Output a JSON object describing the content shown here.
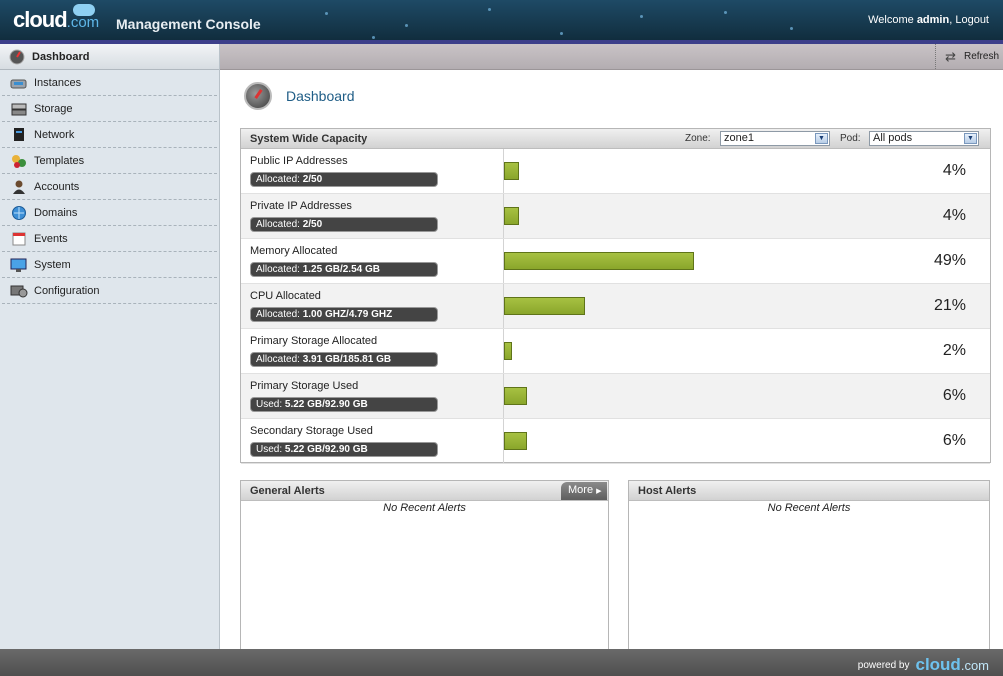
{
  "header": {
    "logo_text": "cloud",
    "logo_suffix": ".com",
    "title": "Management Console",
    "welcome_prefix": "Welcome ",
    "user": "admin",
    "separator": ", ",
    "logout": "Logout"
  },
  "sidebar": {
    "items": [
      {
        "label": "Dashboard",
        "icon": "dashboard-icon",
        "active": true
      },
      {
        "label": "Instances",
        "icon": "instances-icon"
      },
      {
        "label": "Storage",
        "icon": "storage-icon"
      },
      {
        "label": "Network",
        "icon": "network-icon"
      },
      {
        "label": "Templates",
        "icon": "templates-icon"
      },
      {
        "label": "Accounts",
        "icon": "accounts-icon"
      },
      {
        "label": "Domains",
        "icon": "domains-icon"
      },
      {
        "label": "Events",
        "icon": "events-icon"
      },
      {
        "label": "System",
        "icon": "system-icon"
      },
      {
        "label": "Configuration",
        "icon": "configuration-icon"
      }
    ]
  },
  "toolbar": {
    "refresh": "Refresh"
  },
  "page": {
    "title": "Dashboard"
  },
  "capacity": {
    "title": "System Wide Capacity",
    "zone_label": "Zone:",
    "zone_value": "zone1",
    "pod_label": "Pod:",
    "pod_value": "All pods",
    "rows": [
      {
        "name": "Public IP Addresses",
        "prefix": "Allocated: ",
        "value": "2/50",
        "percent": 4,
        "percent_label": "4%"
      },
      {
        "name": "Private IP Addresses",
        "prefix": "Allocated: ",
        "value": "2/50",
        "percent": 4,
        "percent_label": "4%"
      },
      {
        "name": "Memory Allocated",
        "prefix": "Allocated: ",
        "value": "1.25 GB/2.54 GB",
        "percent": 49,
        "percent_label": "49%"
      },
      {
        "name": "CPU Allocated",
        "prefix": "Allocated: ",
        "value": "1.00 GHZ/4.79 GHZ",
        "percent": 21,
        "percent_label": "21%"
      },
      {
        "name": "Primary Storage Allocated",
        "prefix": "Allocated: ",
        "value": "3.91 GB/185.81 GB",
        "percent": 2,
        "percent_label": "2%"
      },
      {
        "name": "Primary Storage Used",
        "prefix": "Used: ",
        "value": "5.22 GB/92.90 GB",
        "percent": 6,
        "percent_label": "6%"
      },
      {
        "name": "Secondary Storage Used",
        "prefix": "Used: ",
        "value": "5.22 GB/92.90 GB",
        "percent": 6,
        "percent_label": "6%"
      }
    ],
    "bar_color": "#9bb536"
  },
  "general_alerts": {
    "title": "General Alerts",
    "more": "More",
    "empty": "No Recent Alerts"
  },
  "host_alerts": {
    "title": "Host Alerts",
    "empty": "No Recent Alerts"
  },
  "footer": {
    "powered_by": "powered by",
    "brand": "cloud",
    "brand_suffix": ".com"
  }
}
